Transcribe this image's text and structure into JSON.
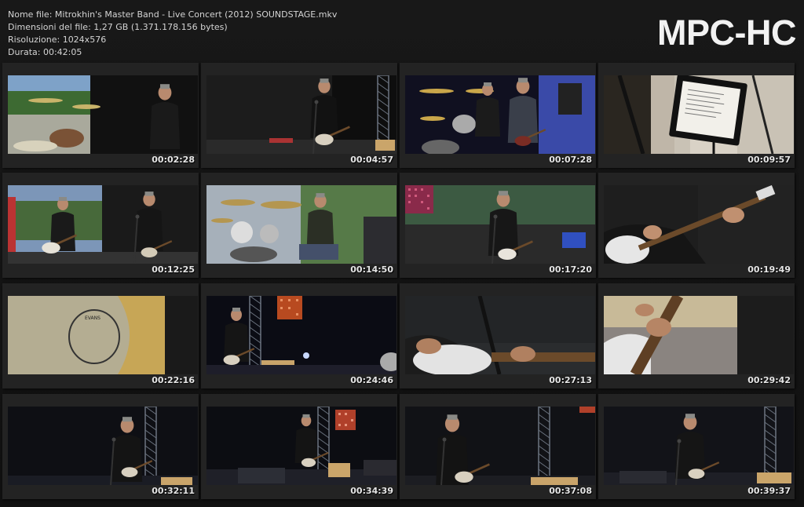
{
  "file_info": {
    "name": "Nome file: Mitrokhin's Master Band - Live Concert (2012) SOUNDSTAGE.mkv",
    "size": "Dimensioni del file: 1,27 GB (1.371.178.156 bytes)",
    "resolution": "Risoluzione: 1024x576",
    "duration": "Durata: 00:42:05"
  },
  "logo": "MPC-HC",
  "thumbnails": [
    {
      "timestamp": "00:02:28",
      "scene": "drummer-outdoor"
    },
    {
      "timestamp": "00:04:57",
      "scene": "guitarist-stage"
    },
    {
      "timestamp": "00:07:28",
      "scene": "drums-band"
    },
    {
      "timestamp": "00:09:57",
      "scene": "lyrics-stand"
    },
    {
      "timestamp": "00:12:25",
      "scene": "two-guitarists"
    },
    {
      "timestamp": "00:14:50",
      "scene": "drummer-kit"
    },
    {
      "timestamp": "00:17:20",
      "scene": "guitarist-sunglasses"
    },
    {
      "timestamp": "00:19:49",
      "scene": "guitar-closeup"
    },
    {
      "timestamp": "00:22:16",
      "scene": "drum-closeup"
    },
    {
      "timestamp": "00:24:46",
      "scene": "guitarist-stage-lights"
    },
    {
      "timestamp": "00:27:13",
      "scene": "guitar-hand-closeup"
    },
    {
      "timestamp": "00:29:42",
      "scene": "fretboard-closeup"
    },
    {
      "timestamp": "00:32:11",
      "scene": "singer-guitar"
    },
    {
      "timestamp": "00:34:39",
      "scene": "wide-stage"
    },
    {
      "timestamp": "00:37:08",
      "scene": "singer-mic"
    },
    {
      "timestamp": "00:39:37",
      "scene": "singer-truss"
    }
  ],
  "colors": {
    "background": "#141414",
    "frame": "#232323",
    "text": "#d4d4d4",
    "logo": "#f2f2f2"
  }
}
